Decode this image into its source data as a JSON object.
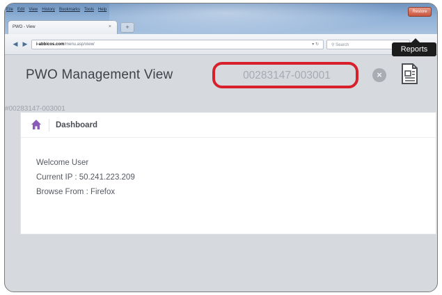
{
  "browser": {
    "menu": [
      "Eile",
      "Edit",
      "View",
      "History",
      "Bookmarks",
      "Tools",
      "Help"
    ],
    "window_button_label": "Restore",
    "tab_title": "PWO - View",
    "tab_close": "×",
    "new_tab": "+",
    "url_domain": "i-abbicos.com",
    "url_path": "/menu.asp/view/",
    "search_placeholder": "Search"
  },
  "header": {
    "title": "PWO Management View",
    "id_value": "00283147-003001",
    "clear_symbol": "×",
    "tooltip": "Reports"
  },
  "record_id": "#00283147-003001",
  "dashboard": {
    "title": "Dashboard",
    "welcome": "Welcome User",
    "ip": "Current IP : 50.241.223.209",
    "browser": "Browse From : Firefox"
  },
  "colors": {
    "highlight_ring": "#d8202a",
    "home_icon": "#8a5bb8"
  }
}
